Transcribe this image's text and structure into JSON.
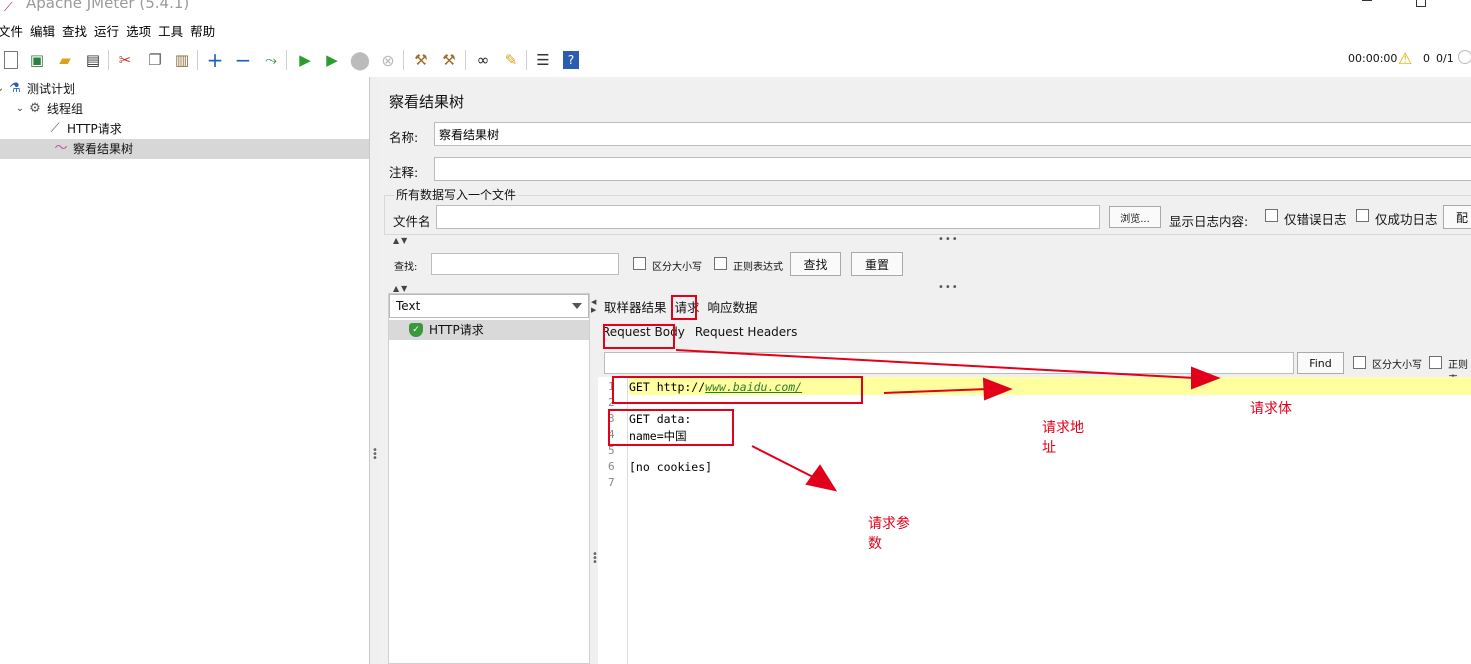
{
  "window": {
    "title": "Apache JMeter (5.4.1)"
  },
  "menu": [
    "文件",
    "编辑",
    "查找",
    "运行",
    "选项",
    "工具",
    "帮助"
  ],
  "toolbar": {
    "timer": "00:00:00",
    "warning_count": "0",
    "threads": "0/1"
  },
  "tree": [
    {
      "label": "测试计划",
      "icon": "flask-icon"
    },
    {
      "label": "线程组",
      "icon": "gear-icon"
    },
    {
      "label": "HTTP请求",
      "icon": "pipette-icon"
    },
    {
      "label": "察看结果树",
      "icon": "graph-icon"
    }
  ],
  "panel": {
    "title": "察看结果树",
    "name_label": "名称:",
    "name_value": "察看结果树",
    "comment_label": "注释:",
    "comment_value": "",
    "file_group_title": "所有数据写入一个文件",
    "filename_label": "文件名",
    "filename_value": "",
    "browse_label": "浏览...",
    "log_label": "显示日志内容:",
    "errors_only": "仅错误日志",
    "success_only": "仅成功日志",
    "config_label": "配"
  },
  "search": {
    "label": "查找:",
    "value": "",
    "case_sensitive": "区分大小写",
    "regex": "正则表达式",
    "find_button": "查找",
    "reset_button": "重置"
  },
  "results": {
    "renderer": "Text",
    "items": [
      {
        "label": "HTTP请求",
        "status": "success"
      }
    ]
  },
  "detail": {
    "tabs": [
      "取样器结果",
      "请求",
      "响应数据"
    ],
    "sub_tabs": [
      "Request Body",
      "Request Headers"
    ],
    "find_button": "Find",
    "case_sensitive": "区分大小写",
    "regex_partial": "正则表",
    "code_lines": [
      {
        "no": "1",
        "text": "GET http://",
        "link": "www.baidu.com/"
      },
      {
        "no": "2",
        "text": ""
      },
      {
        "no": "3",
        "text": "GET data:"
      },
      {
        "no": "4",
        "text": "name=中国"
      },
      {
        "no": "5",
        "text": ""
      },
      {
        "no": "6",
        "text": "[no cookies]"
      },
      {
        "no": "7",
        "text": ""
      }
    ]
  },
  "annotations": {
    "request_address": [
      "请求地",
      "址"
    ],
    "request_body": "请求体",
    "request_params": [
      "请求参",
      "数"
    ],
    "color": "#e2001a"
  }
}
